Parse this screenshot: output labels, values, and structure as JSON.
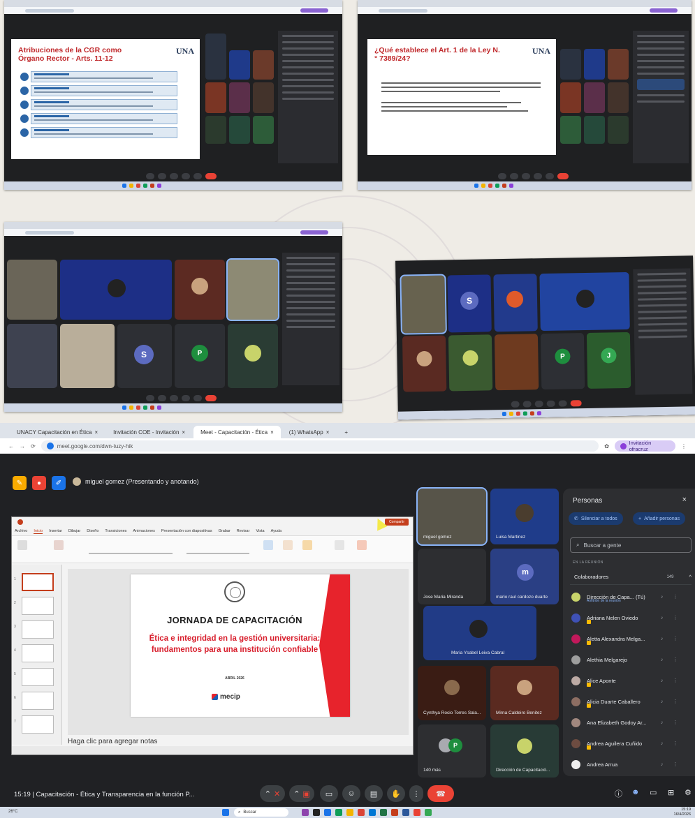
{
  "shot1": {
    "slide_title": "Atribuciones de la CGR como Órgano Rector - Arts. 11-12",
    "logo": "UNA"
  },
  "shot2": {
    "slide_title": "¿Qué establece el Art. 1 de la Ley N.° 7389/24?",
    "logo": "UNA"
  },
  "shot3": {
    "tile_letters": [
      "S",
      "P"
    ]
  },
  "shot4": {
    "tile_letters": [
      "S",
      "P",
      "J"
    ]
  },
  "browser": {
    "tabs": [
      "UNACY Capacitación en Ética",
      "Invitación COE - Invitación",
      "Meet - Capacitación - Ética",
      "(1) WhatsApp"
    ],
    "url": "meet.google.com/dwn-tuzy-hik",
    "account": "Invitación ofracruz"
  },
  "meet": {
    "presenter": "miguel gomez (Presentando y anotando)",
    "bottom_info": "15:19  |  Capacitación - Ética y Transparencia en la función P..."
  },
  "ppt": {
    "menu": [
      "Archivo",
      "Inicio",
      "Insertar",
      "Dibujar",
      "Diseño",
      "Transiciones",
      "Animaciones",
      "Presentación con diapositivas",
      "Grabar",
      "Revisar",
      "Vista",
      "Ayuda"
    ],
    "share": "Compartir",
    "slide_title": "JORNADA DE CAPACITACIÓN",
    "slide_subtitle_1": "Ética e integridad en la gestión universitaria:",
    "slide_subtitle_2": "fundamentos para una institución confiable",
    "slide_date": "ABRIL 2026",
    "brand": "mecip",
    "notes": "Haga clic para agregar notas"
  },
  "tiles": [
    {
      "name": "miguel gomez"
    },
    {
      "name": "Luisa Martinez"
    },
    {
      "name": "Jose Maria Miranda"
    },
    {
      "name": "mario raul cardozo duarte",
      "letter": "m"
    },
    {
      "name": "Maria Ysabel Leiva Cabral"
    },
    {
      "name": "Cynthya Rocio Torres Sala..."
    },
    {
      "name": "Mirna Caldeiro Benitez"
    },
    {
      "name": "140 más",
      "letter": "P"
    },
    {
      "name": "Dirección de Capacitació..."
    }
  ],
  "people": {
    "title": "Personas",
    "silence_btn": "Silenciar a todos",
    "add_btn": "Añadir personas",
    "search_placeholder": "Buscar a gente",
    "section": "EN LA REUNIÓN",
    "group": "Colaboradores",
    "group_count": "149",
    "rows": [
      {
        "name": "Dirección de Capa... (Tú)",
        "sub": "Anfitrión de la reunión"
      },
      {
        "name": "Adriana Nelen Oviedo"
      },
      {
        "name": "Aletta Alexandra Melga..."
      },
      {
        "name": "Alethia Melgarejo"
      },
      {
        "name": "Alice Aponte"
      },
      {
        "name": "Alicia Duarte Caballero"
      },
      {
        "name": "Ana Elizabeth Godoy Ar..."
      },
      {
        "name": "Andrea Aguilera Cuñido"
      },
      {
        "name": "Andrea Arrua"
      }
    ]
  },
  "taskbar": {
    "search": "Buscar",
    "weather": "26°C",
    "time": "15:19",
    "date": "16/4/2026"
  },
  "colors": {
    "meet_bg": "#202124",
    "hangup": "#ea4335",
    "accent_red": "#e7232c",
    "meet_blue": "#1a73e8"
  }
}
